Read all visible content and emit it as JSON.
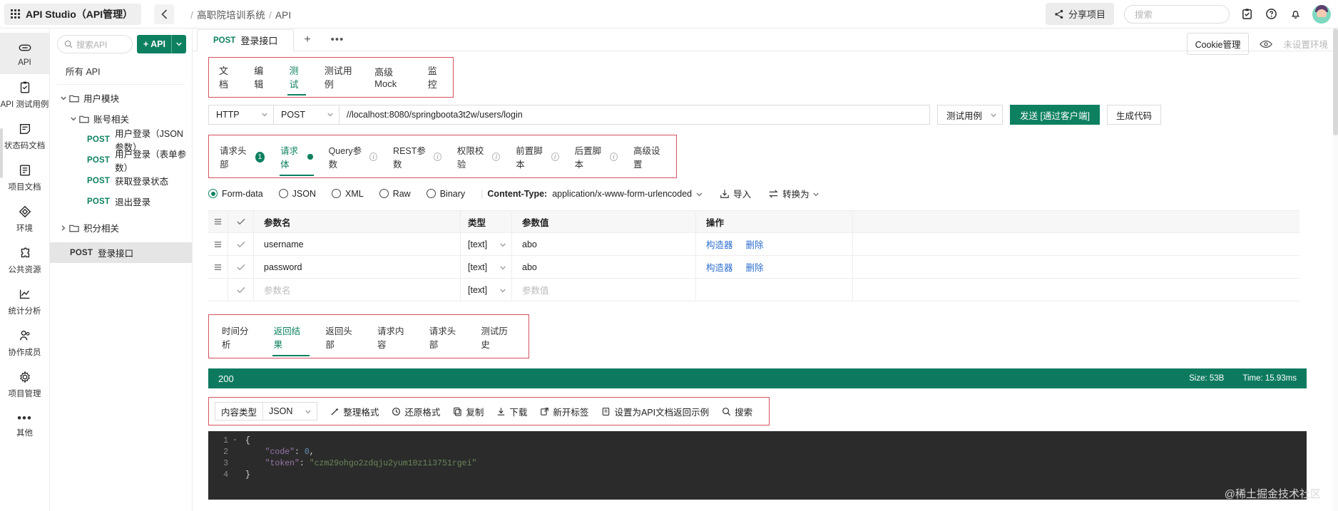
{
  "header": {
    "app_title": "API Studio（API管理）",
    "breadcrumb_project": "高职院培训系统",
    "breadcrumb_section": "API",
    "breadcrumb_sep": "/",
    "share_label": "分享项目",
    "search_placeholder": "搜索"
  },
  "rail": {
    "items": [
      {
        "label": "API",
        "icon": "link-icon"
      },
      {
        "label": "API 测试用例",
        "icon": "clipboard-check-icon"
      },
      {
        "label": "状态码文档",
        "icon": "note-icon"
      },
      {
        "label": "项目文档",
        "icon": "book-icon"
      },
      {
        "label": "环境",
        "icon": "cube-icon"
      },
      {
        "label": "公共资源",
        "icon": "puzzle-icon"
      },
      {
        "label": "统计分析",
        "icon": "chart-icon"
      },
      {
        "label": "协作成员",
        "icon": "members-icon"
      },
      {
        "label": "项目管理",
        "icon": "gear-icon"
      },
      {
        "label": "其他",
        "icon": "ellipsis-icon"
      }
    ],
    "active_index": 0
  },
  "tree": {
    "search_placeholder": "搜索API",
    "add_button": "+ API",
    "all_api": "所有 API",
    "folders": [
      {
        "label": "用户模块",
        "level": 1,
        "expanded": true
      },
      {
        "label": "账号相关",
        "level": 2,
        "expanded": true
      }
    ],
    "apis": [
      {
        "method": "POST",
        "name": "用户登录（JSON参数）"
      },
      {
        "method": "POST",
        "name": "用户登录（表单参数）"
      },
      {
        "method": "POST",
        "name": "获取登录状态"
      },
      {
        "method": "POST",
        "name": "退出登录"
      }
    ],
    "folder2": {
      "label": "积分相关",
      "level": 1,
      "expanded": false
    },
    "selected_api": {
      "method": "POST",
      "name": "登录接口"
    }
  },
  "doc_tab": {
    "method": "POST",
    "name": "登录接口",
    "add": "+",
    "more": "•••"
  },
  "subtabs": {
    "items": [
      "文档",
      "编辑",
      "测试",
      "测试用例",
      "高级Mock",
      "监控"
    ],
    "active": "测试"
  },
  "url_row": {
    "protocol": "HTTP",
    "method": "POST",
    "url": "//localhost:8080/springboota3t2w/users/login",
    "testcase_button": "测试用例",
    "send_button": "发送 [通过客户端]",
    "gen_code_button": "生成代码"
  },
  "cookie_row": {
    "cookie_button": "Cookie管理",
    "env_text": "未设置环境"
  },
  "param_tabs": {
    "items": [
      {
        "label": "请求头部",
        "badge": "1"
      },
      {
        "label": "请求体",
        "dot": true
      },
      {
        "label": "Query参数",
        "info": true
      },
      {
        "label": "REST参数",
        "info": true
      },
      {
        "label": "权限校验",
        "info": true
      },
      {
        "label": "前置脚本",
        "info": true
      },
      {
        "label": "后置脚本",
        "info": true
      },
      {
        "label": "高级设置"
      }
    ],
    "active": "请求体"
  },
  "body_type": {
    "options": [
      "Form-data",
      "JSON",
      "XML",
      "Raw",
      "Binary"
    ],
    "selected": "Form-data",
    "content_type_label": "Content-Type:",
    "content_type_value": "application/x-www-form-urlencoded",
    "import_label": "导入",
    "convert_label": "转换为"
  },
  "params_table": {
    "headers": [
      "参数名",
      "类型",
      "参数值",
      "操作"
    ],
    "rows": [
      {
        "name": "username",
        "type": "[text]",
        "value": "abo",
        "actions": [
          "构造器",
          "删除"
        ]
      },
      {
        "name": "password",
        "type": "[text]",
        "value": "abo",
        "actions": [
          "构造器",
          "删除"
        ]
      }
    ],
    "empty_row": {
      "name_placeholder": "参数名",
      "type": "[text]",
      "value_placeholder": "参数值"
    }
  },
  "response_tabs": {
    "items": [
      "时间分析",
      "返回结果",
      "返回头部",
      "请求内容",
      "请求头部",
      "测试历史"
    ],
    "active": "返回结果"
  },
  "status": {
    "code": "200",
    "size_label": "Size:",
    "size_value": "53B",
    "time_label": "Time:",
    "time_value": "15.93ms"
  },
  "response_toolbar": {
    "type_label": "内容类型",
    "type_value": "JSON",
    "buttons": [
      "整理格式",
      "还原格式",
      "复制",
      "下载",
      "新开标签",
      "设置为API文档返回示例",
      "搜索"
    ]
  },
  "response_body": {
    "lines": [
      {
        "no": "1",
        "fold": "-",
        "text": "{"
      },
      {
        "no": "2",
        "fold": "",
        "key": "\"code\"",
        "sep": ": ",
        "num": "0",
        "tail": ","
      },
      {
        "no": "3",
        "fold": "",
        "key": "\"token\"",
        "sep": ": ",
        "str": "\"czm29ohgo2zdqju2yum10z1i3751rgei\"",
        "tail": ""
      },
      {
        "no": "4",
        "fold": "",
        "text": "}"
      }
    ]
  },
  "watermark": "@稀土掘金技术社区",
  "colors": {
    "accent": "#0d8060",
    "status_bar": "#0d7a5f",
    "outline": "#d4525f",
    "link": "#2f6fcf"
  }
}
